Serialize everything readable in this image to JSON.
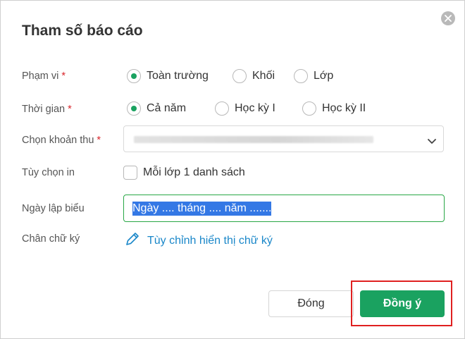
{
  "dialog": {
    "title": "Tham số báo cáo",
    "close_icon": "close-circle-icon"
  },
  "form": {
    "scope": {
      "label": "Phạm vi",
      "required": "*",
      "options": [
        "Toàn trường",
        "Khối",
        "Lớp"
      ],
      "selected": "Toàn trường"
    },
    "time": {
      "label": "Thời gian",
      "required": "*",
      "options": [
        "Cả năm",
        "Học kỳ I",
        "Học kỳ II"
      ],
      "selected": "Cả năm"
    },
    "fee": {
      "label": "Chọn khoản thu",
      "required": "*",
      "value": "",
      "icon": "chevron-down-icon"
    },
    "print_option": {
      "label": "Tùy chọn in",
      "checkbox_label": "Mỗi lớp 1 danh sách",
      "checked": false
    },
    "date": {
      "label": "Ngày lập biểu",
      "value": "Ngày .... tháng .... năm ......."
    },
    "signature": {
      "label": "Chân chữ ký",
      "link_text": "Tùy chỉnh hiển thị chữ ký",
      "icon": "pencil-icon"
    }
  },
  "footer": {
    "close_label": "Đóng",
    "ok_label": "Đồng ý"
  },
  "colors": {
    "accent": "#1aa260",
    "link": "#1a87c9",
    "required": "#d9262c",
    "highlight": "#e02020"
  }
}
